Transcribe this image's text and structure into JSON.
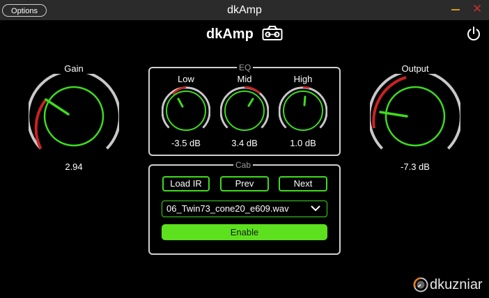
{
  "window": {
    "options_label": "Options",
    "title": "dkAmp"
  },
  "header": {
    "brand": "dkAmp",
    "icons": [
      "radio-icon",
      "power-icon"
    ]
  },
  "colors": {
    "accent_green": "#3ddc1e",
    "enable_green": "#5de11e",
    "arc_red": "#cc2222",
    "arc_gray": "#c8c8c8",
    "minimize": "#d89a1e",
    "close": "#c8302b"
  },
  "knobs": {
    "gain": {
      "label": "Gain",
      "value": "2.94"
    },
    "output": {
      "label": "Output",
      "value": "-7.3 dB"
    }
  },
  "eq": {
    "title": "EQ",
    "low": {
      "label": "Low",
      "value": "-3.5 dB"
    },
    "mid": {
      "label": "Mid",
      "value": "3.4 dB"
    },
    "high": {
      "label": "High",
      "value": "1.0 dB"
    }
  },
  "cab": {
    "title": "Cab",
    "load_label": "Load IR",
    "prev_label": "Prev",
    "next_label": "Next",
    "ir_file": "06_Twin73_cone20_e609.wav",
    "enable_label": "Enable"
  },
  "footer": {
    "logo_text": "dkuzniar"
  }
}
